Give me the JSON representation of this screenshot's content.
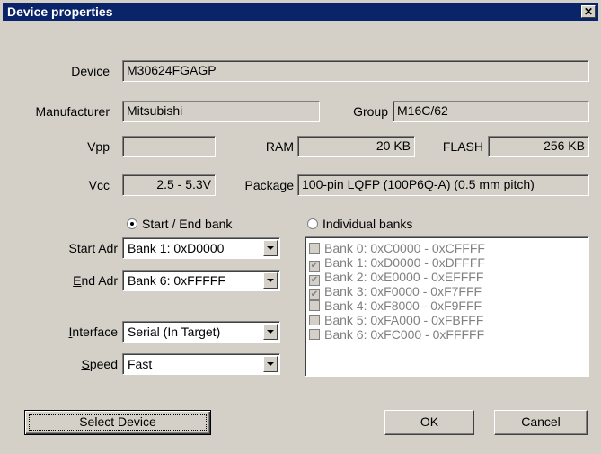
{
  "dialog": {
    "title": "Device properties",
    "close_glyph": "✕"
  },
  "labels": {
    "device": "Device",
    "manufacturer": "Manufacturer",
    "group": "Group",
    "vpp": "Vpp",
    "ram": "RAM",
    "flash": "FLASH",
    "vcc": "Vcc",
    "package": "Package"
  },
  "values": {
    "device": "M30624FGAGP",
    "manufacturer": "Mitsubishi",
    "group": "M16C/62",
    "vpp": "",
    "ram": "20 KB",
    "flash": "256 KB",
    "vcc": "2.5 - 5.3V",
    "package": "100-pin LQFP (100P6Q-A) (0.5 mm pitch)"
  },
  "mode": {
    "start_end_label": "Start / End bank",
    "individual_label": "Individual banks",
    "selected": "start_end"
  },
  "start_adr": {
    "label_underline": "S",
    "label_rest": "tart Adr",
    "value": "Bank  1: 0xD0000"
  },
  "end_adr": {
    "label_underline": "E",
    "label_rest": "nd Adr",
    "value": "Bank  6: 0xFFFFF"
  },
  "interface": {
    "label_underline": "I",
    "label_rest": "nterface",
    "value": "Serial (In Target)"
  },
  "speed": {
    "label_underline": "S",
    "label_rest": "peed",
    "value": "Fast"
  },
  "banks": [
    {
      "label": "Bank  0: 0xC0000 - 0xCFFFF",
      "checked": false
    },
    {
      "label": "Bank  1: 0xD0000 - 0xDFFFF",
      "checked": true
    },
    {
      "label": "Bank  2: 0xE0000 - 0xEFFFF",
      "checked": true
    },
    {
      "label": "Bank  3: 0xF0000 - 0xF7FFF",
      "checked": true
    },
    {
      "label": "Bank  4: 0xF8000 - 0xF9FFF",
      "checked": false
    },
    {
      "label": "Bank  5: 0xFA000 - 0xFBFFF",
      "checked": false
    },
    {
      "label": "Bank  6: 0xFC000 - 0xFFFFF",
      "checked": false
    }
  ],
  "buttons": {
    "select_device": "Select Device",
    "ok": "OK",
    "cancel": "Cancel"
  },
  "colors": {
    "titlebar": "#0a246a",
    "face": "#d4d0c8",
    "disabled_text": "#808080"
  }
}
